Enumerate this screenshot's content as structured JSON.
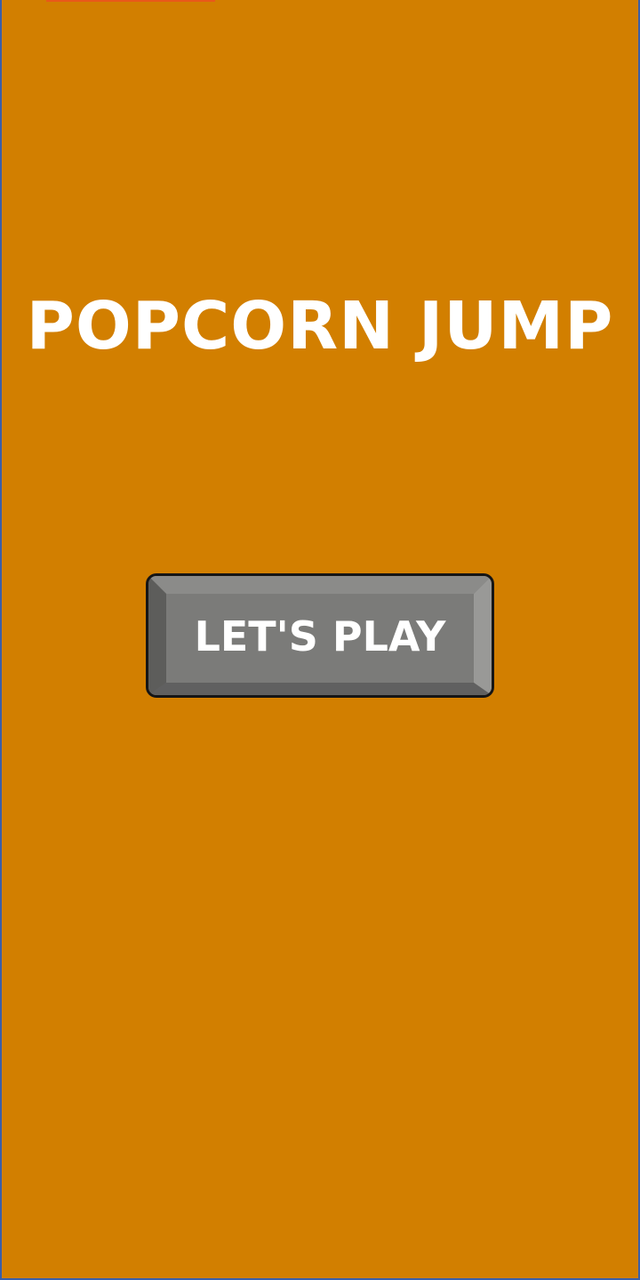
{
  "game": {
    "title": "POPCORN JUMP",
    "play_label": "LET'S PLAY"
  },
  "colors": {
    "background": "#d27f00",
    "title_text": "#ffffff",
    "button_face": "#7b7b79",
    "button_border": "#151515",
    "frame": "#3a5fa8"
  }
}
